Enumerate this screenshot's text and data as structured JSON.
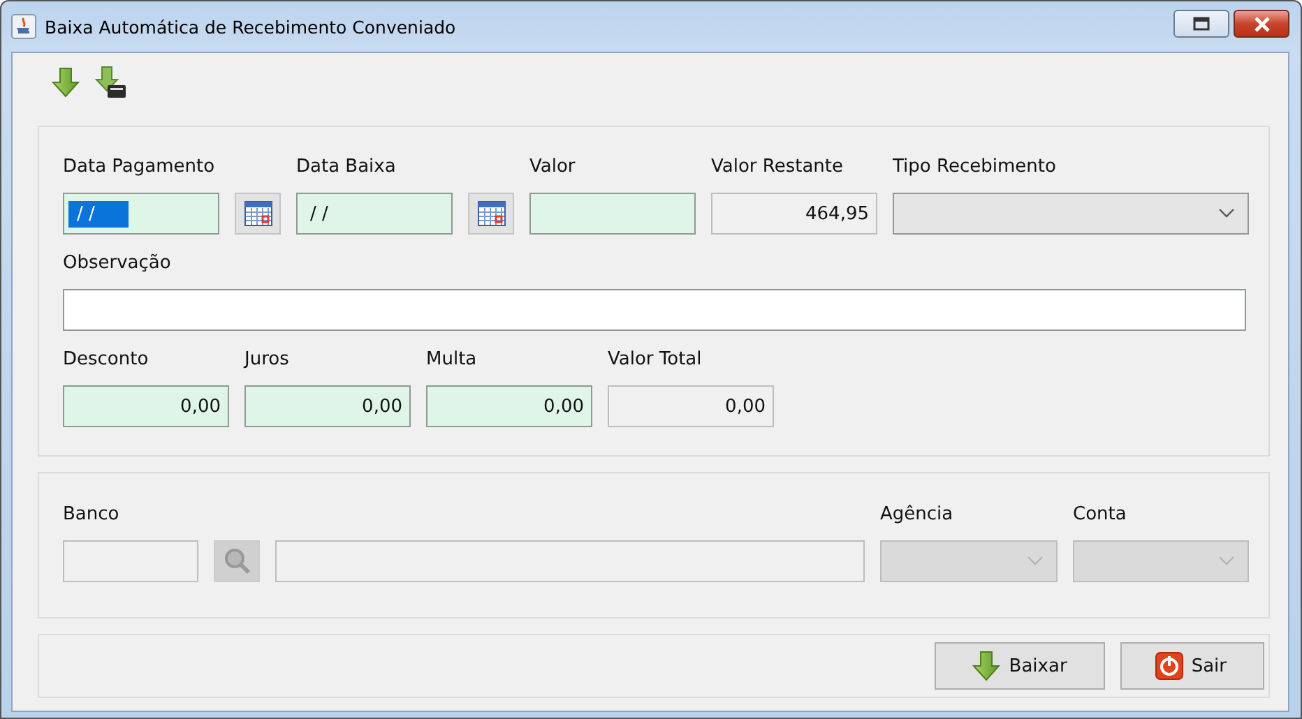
{
  "window": {
    "title": "Baixa Automática de Recebimento Conveniado"
  },
  "toolbar": [
    {
      "kind": "download"
    },
    {
      "kind": "tef"
    }
  ],
  "sections": [
    {
      "rows": [
        [
          {
            "label": "Data Pagamento",
            "kind": "date",
            "value": "/ /",
            "text_selected": true,
            "disabled": false
          },
          {
            "label": "Data Baixa",
            "kind": "date",
            "value": "/ /",
            "text_selected": false,
            "disabled": false
          },
          {
            "label": "Valor",
            "kind": "text",
            "disabled": false
          },
          {
            "label": "Valor Restante",
            "kind": "text",
            "value": "464,95",
            "disabled": true
          },
          {
            "label": "Tipo Recebimento",
            "kind": "combo",
            "disabled": false
          }
        ],
        [
          {
            "label": "Observação",
            "kind": "memo",
            "disabled": false
          }
        ],
        [
          {
            "label": "Desconto",
            "kind": "text",
            "value": "0,00",
            "disabled": false
          },
          {
            "label": "Juros",
            "kind": "text",
            "value": "0,00",
            "disabled": false
          },
          {
            "label": "Multa",
            "kind": "text",
            "value": "0,00",
            "disabled": false
          },
          {
            "label": "Valor Total",
            "kind": "text",
            "value": "0,00",
            "disabled": true
          }
        ]
      ]
    },
    {
      "rows": [
        [
          {
            "label": "Banco",
            "kind": "lookup",
            "disabled": true
          },
          {
            "label": "Agência",
            "kind": "combo",
            "disabled": true
          },
          {
            "label": "Conta",
            "kind": "combo",
            "disabled": true
          }
        ]
      ]
    }
  ],
  "buttons": [
    {
      "label": "Baixar",
      "kind": "download"
    },
    {
      "label": "Sair",
      "kind": "exit"
    }
  ]
}
